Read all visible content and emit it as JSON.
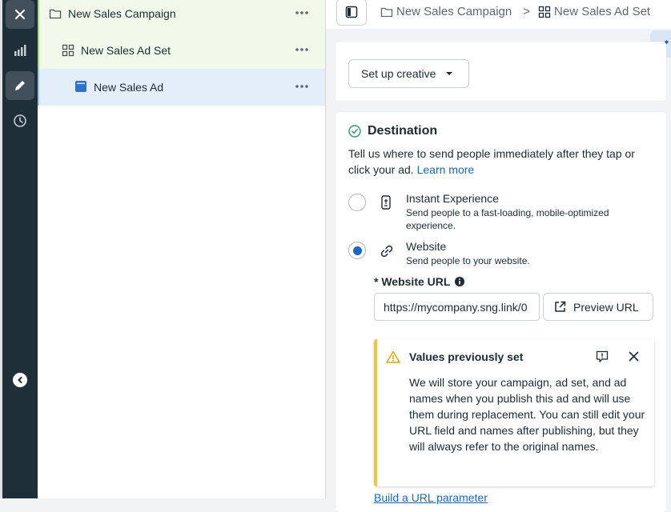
{
  "tree": {
    "campaign": "New Sales Campaign",
    "adset": "New Sales Ad Set",
    "ad": "New Sales Ad"
  },
  "breadcrumb": {
    "campaign": "New Sales Campaign",
    "separator": ">",
    "adset": "New Sales Ad Set"
  },
  "creative": {
    "button_label": "Set up creative"
  },
  "destination": {
    "title": "Destination",
    "description": "Tell us where to send people immediately after they tap or click your ad.",
    "learn_more": "Learn more",
    "options": [
      {
        "title": "Instant Experience",
        "subtitle": "Send people to a fast-loading, mobile-optimized experience.",
        "selected": false
      },
      {
        "title": "Website",
        "subtitle": "Send people to your website.",
        "selected": true
      }
    ],
    "website_url_label": "* Website URL",
    "website_url_value": "https://mycompany.sng.link/0",
    "preview_button": "Preview URL"
  },
  "notice": {
    "title": "Values previously set",
    "body": "We will store your campaign, ad set, and ad names when you publish this ad and will use them during replacement. You can still edit your URL field and names after publishing, but they will always refer to the original names."
  },
  "footer_link": "Build a URL parameter",
  "colors": {
    "rail": "#1f2f3a",
    "accent_blue": "#1668c5",
    "warning_yellow": "#f5c33b",
    "campaign_row_bg": "#f1f9ea",
    "ad_row_bg": "#e4eefa"
  }
}
